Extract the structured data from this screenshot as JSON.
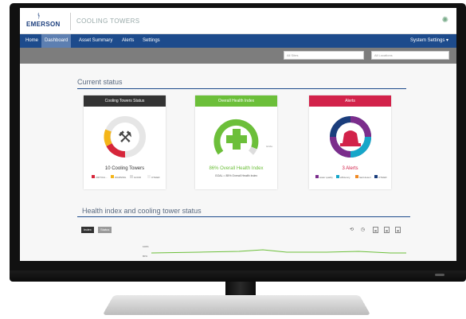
{
  "brand": {
    "logo": "EMERSON",
    "title": "COOLING TOWERS"
  },
  "nav": {
    "items": [
      "Home",
      "Dashboard",
      "Asset Summary",
      "Alerts",
      "Settings"
    ],
    "right": "System Settings ▾"
  },
  "filters": {
    "first": "All Sites",
    "second": "All Locations"
  },
  "current_status": {
    "heading": "Current status",
    "towers": {
      "header": "Cooling Towers Status",
      "caption": "10 Cooling Towers",
      "legend": [
        "CRITICA...",
        "WARNING",
        "GOOD",
        "OTHER"
      ]
    },
    "health": {
      "header": "Overall Health Index",
      "caption": "86% Overall Health Index",
      "sub": "GOAL = 85% Overall Health Index",
      "goal_tick": "GOAL"
    },
    "alerts": {
      "header": "Alerts",
      "caption": "3 Alerts",
      "legend": [
        "water quality",
        "efficiency",
        "fault detect",
        "OTHER"
      ]
    }
  },
  "health_section": {
    "heading": "Health index and cooling tower status",
    "toggle": [
      "Index",
      "Status"
    ],
    "y_ticks": [
      "100%",
      "80%"
    ]
  },
  "colors": {
    "nav": "#1d4b8c",
    "towers_head": "#333333",
    "health_head": "#6cbf3a",
    "alerts_head": "#d2224a"
  }
}
